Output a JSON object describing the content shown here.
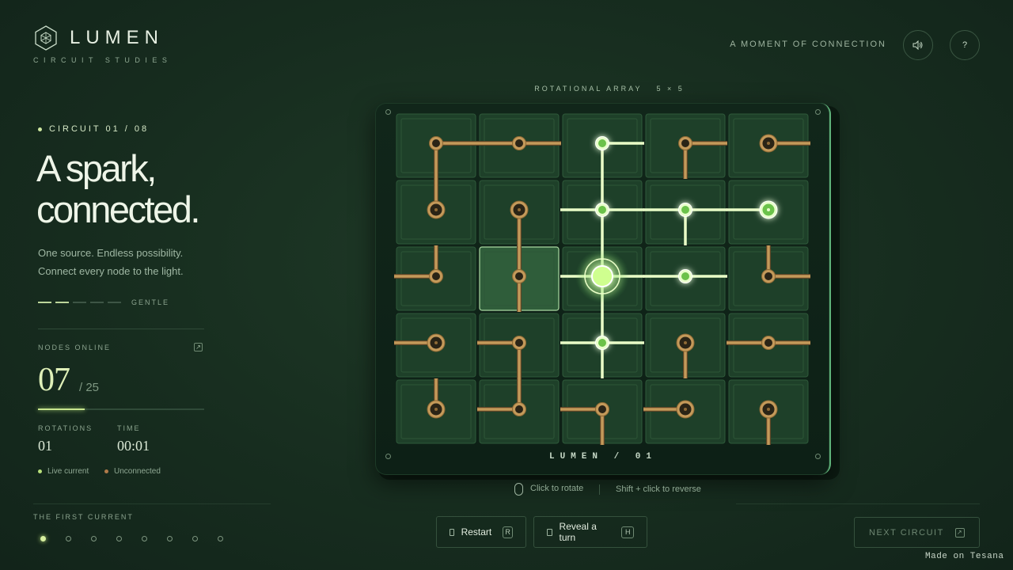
{
  "brand": {
    "name": "LUMEN",
    "subtitle": "CIRCUIT STUDIES"
  },
  "header": {
    "tagline": "A MOMENT OF CONNECTION",
    "sound_icon": "speaker-icon",
    "help_label": "?"
  },
  "circuit": {
    "label": "CIRCUIT 01 / 08",
    "headline_line1": "A spark,",
    "headline_line2": "connected.",
    "desc_line1": "One source. Endless possibility.",
    "desc_line2": "Connect every node to the light.",
    "difficulty": {
      "label": "GENTLE",
      "level": 2,
      "max": 5
    }
  },
  "stats": {
    "nodes_label": "NODES ONLINE",
    "nodes_online": "07",
    "nodes_total": "/ 25",
    "progress": 0.28,
    "rotations_label": "ROTATIONS",
    "rotations": "01",
    "time_label": "TIME",
    "time": "00:01",
    "legend_live": "Live current",
    "legend_unconnected": "Unconnected"
  },
  "levels": {
    "title": "THE FIRST CURRENT",
    "count": 8,
    "active_index": 0
  },
  "board": {
    "label": "ROTATIONAL ARRAY",
    "size_label": "5 × 5",
    "caption": "LUMEN / 01",
    "selected": [
      2,
      1
    ],
    "tiles": [
      [
        {
          "conn": "ES",
          "lit": false,
          "end": false
        },
        {
          "conn": "EW",
          "lit": false,
          "end": false
        },
        {
          "conn": "ES",
          "lit": true,
          "end": false
        },
        {
          "conn": "ES",
          "lit": false,
          "end": false
        },
        {
          "conn": "E",
          "lit": false,
          "end": true
        }
      ],
      [
        {
          "conn": "N",
          "lit": false,
          "end": true
        },
        {
          "conn": "S",
          "lit": false,
          "end": true
        },
        {
          "conn": "NESW",
          "lit": true,
          "end": false
        },
        {
          "conn": "ESW",
          "lit": true,
          "end": false
        },
        {
          "conn": "W",
          "lit": true,
          "end": true
        }
      ],
      [
        {
          "conn": "NW",
          "lit": false,
          "end": false
        },
        {
          "conn": "NS",
          "lit": false,
          "end": false
        },
        {
          "conn": "NESW",
          "lit": true,
          "end": false,
          "source": true
        },
        {
          "conn": "EW",
          "lit": true,
          "end": false
        },
        {
          "conn": "NE",
          "lit": false,
          "end": false
        }
      ],
      [
        {
          "conn": "W",
          "lit": false,
          "end": true
        },
        {
          "conn": "SW",
          "lit": false,
          "end": false
        },
        {
          "conn": "NESW",
          "lit": true,
          "end": false
        },
        {
          "conn": "S",
          "lit": false,
          "end": true
        },
        {
          "conn": "EW",
          "lit": false,
          "end": false
        }
      ],
      [
        {
          "conn": "N",
          "lit": false,
          "end": true
        },
        {
          "conn": "NW",
          "lit": false,
          "end": false
        },
        {
          "conn": "SW",
          "lit": false,
          "end": false
        },
        {
          "conn": "W",
          "lit": false,
          "end": true
        },
        {
          "conn": "S",
          "lit": false,
          "end": true
        }
      ]
    ]
  },
  "hints": {
    "click": "Click to rotate",
    "shift": "Shift + click to reverse"
  },
  "actions": {
    "restart_label": "Restart",
    "restart_key": "R",
    "reveal_label": "Reveal a turn",
    "reveal_key": "H",
    "next_label": "NEXT CIRCUIT"
  },
  "footer": {
    "made_on": "Made on Tesana"
  },
  "colors": {
    "background": "#172d1f",
    "live": "#b8f07a",
    "unconnected": "#c49a5a",
    "accent": "#d8f0a0"
  }
}
